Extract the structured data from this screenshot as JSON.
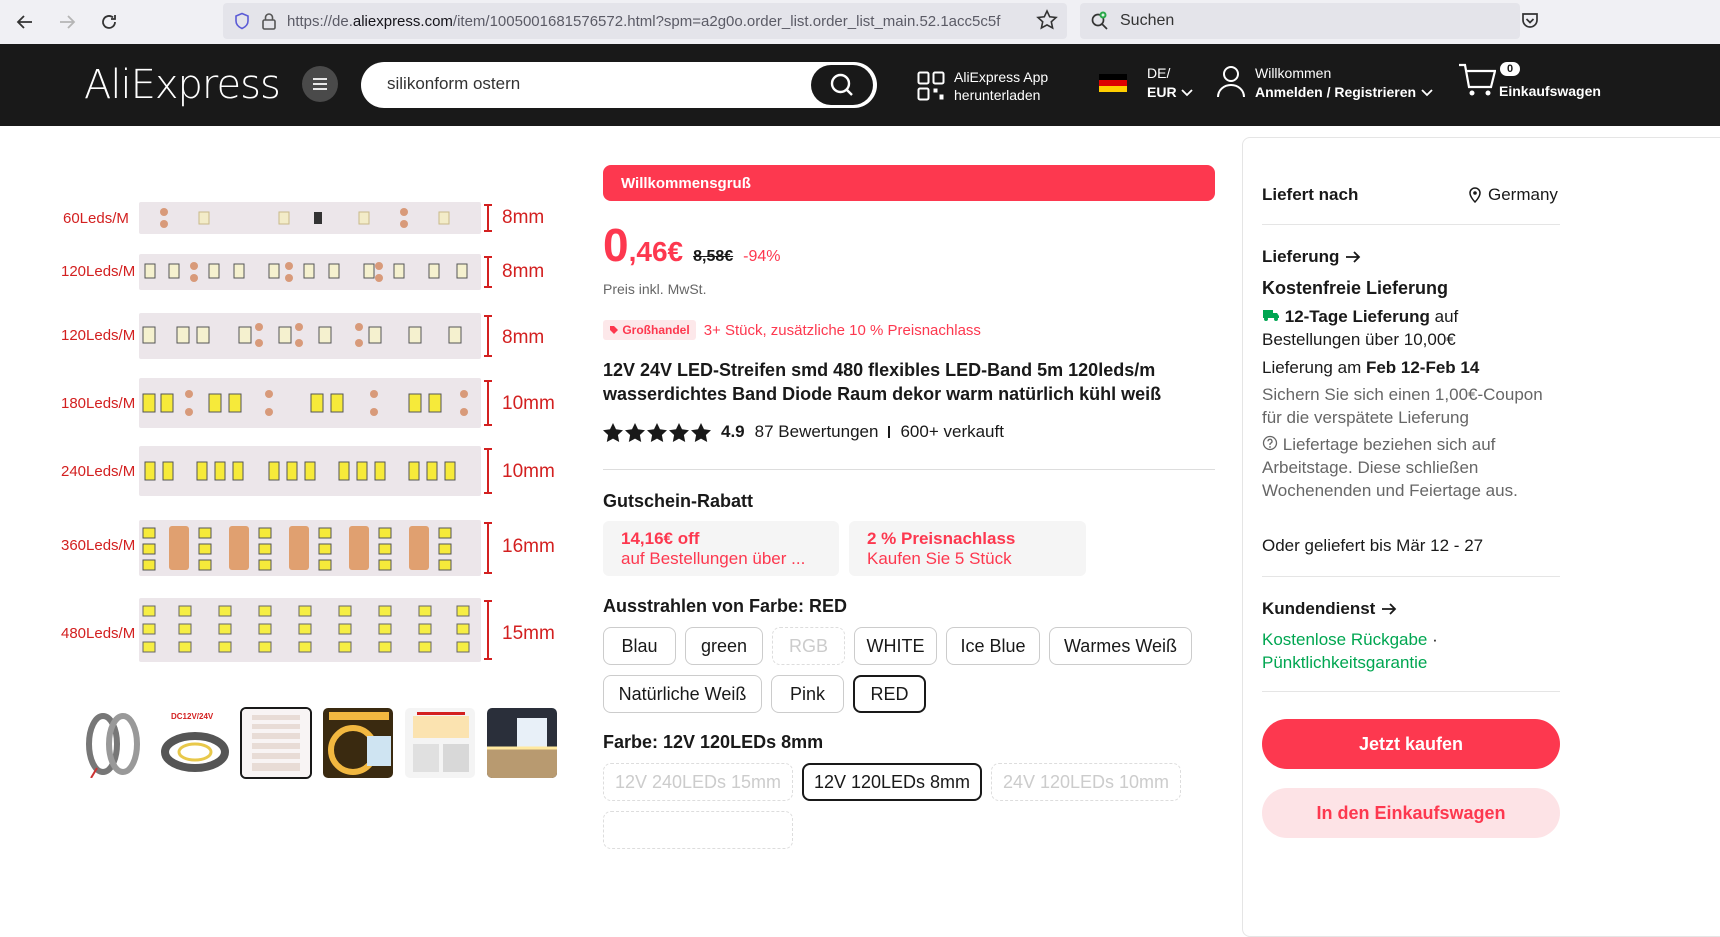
{
  "browser": {
    "url_prefix": "https://de.",
    "url_domain": "aliexpress.com",
    "url_rest": "/item/1005001681576572.html?spm=a2g0o.order_list.order_list_main.52.1acc5c5f",
    "search_placeholder": "Suchen"
  },
  "header": {
    "logo": "AliExpress",
    "search_value": "silikonform ostern",
    "app_line1": "AliExpress App",
    "app_line2": "herunterladen",
    "lang_line1": "DE/",
    "lang_line2": "EUR",
    "user_line1": "Willkommen",
    "user_line2": "Anmelden / Registrieren",
    "cart_count": "0",
    "cart_label": "Einkaufswagen"
  },
  "gallery": {
    "strips": [
      {
        "label": "60Leds/M",
        "size": "8mm"
      },
      {
        "label": "120Leds/M",
        "size": "8mm"
      },
      {
        "label": "120Leds/M",
        "size": "8mm"
      },
      {
        "label": "180Leds/M",
        "size": "10mm"
      },
      {
        "label": "240Leds/M",
        "size": "10mm"
      },
      {
        "label": "360Leds/M",
        "size": "16mm"
      },
      {
        "label": "480Leds/M",
        "size": "15mm"
      }
    ],
    "thumb2_text": "DC12V/24V"
  },
  "product": {
    "promo": "Willkommensgruß",
    "price_int": "0",
    "price_dec": ",46€",
    "price_old": "8,58€",
    "discount": "-94%",
    "tax_note": "Preis inkl. MwSt.",
    "wholesale_badge": "Großhandel",
    "wholesale_text": "3+ Stück, zusätzliche 10 % Preisnachlass",
    "title": "12V 24V LED-Streifen smd 480 flexibles LED-Band 5m 120leds/m wasserdichtes Band Diode Raum dekor warm natürlich kühl weiß",
    "rating": "4.9",
    "reviews": "87 Bewertungen",
    "sold": "600+ verkauft",
    "coupon_heading": "Gutschein-Rabatt",
    "coupon1_title": "14,16€ off",
    "coupon1_sub": "auf Bestellungen über ...",
    "coupon2_title": "2 % Preisnachlass",
    "coupon2_sub": "Kaufen Sie 5 Stück",
    "color_heading": "Ausstrahlen von Farbe: RED",
    "colors": [
      "Blau",
      "green",
      "RGB",
      "WHITE",
      "Ice Blue",
      "Warmes Weiß",
      "Natürliche Weiß",
      "Pink",
      "RED"
    ],
    "variant_heading": "Farbe: 12V 120LEDs 8mm",
    "variants": [
      "12V 240LEDs 15mm",
      "12V 120LEDs 8mm",
      "24V 120LEDs 10mm"
    ]
  },
  "shipping": {
    "ships_to_label": "Liefert nach",
    "ships_to_value": "Germany",
    "delivery_heading": "Lieferung",
    "free_delivery": "Kostenfreie Lieferung",
    "days_bold": "12-Tage Lieferung",
    "days_rest": " auf Bestellungen über 10,00€",
    "delivery_date_prefix": "Lieferung am ",
    "delivery_date": "Feb 12-Feb 14",
    "coupon_note": "Sichern Sie sich einen 1,00€-Coupon für die verspätete Lieferung",
    "workdays_note": "Liefertage beziehen sich auf Arbeitstage. Diese schließen Wochenenden und Feiertage aus.",
    "alt_delivery": "Oder geliefert bis Mär 12 - 27",
    "service_heading": "Kundendienst",
    "service_link1": "Kostenlose Rückgabe",
    "service_link2": "Pünktlichkeitsgarantie",
    "buy_now": "Jetzt kaufen",
    "add_to_cart": "In den Einkaufswagen"
  },
  "colors": {
    "accent": "#fd384f",
    "header_bg": "#191919",
    "green": "#00a651"
  }
}
